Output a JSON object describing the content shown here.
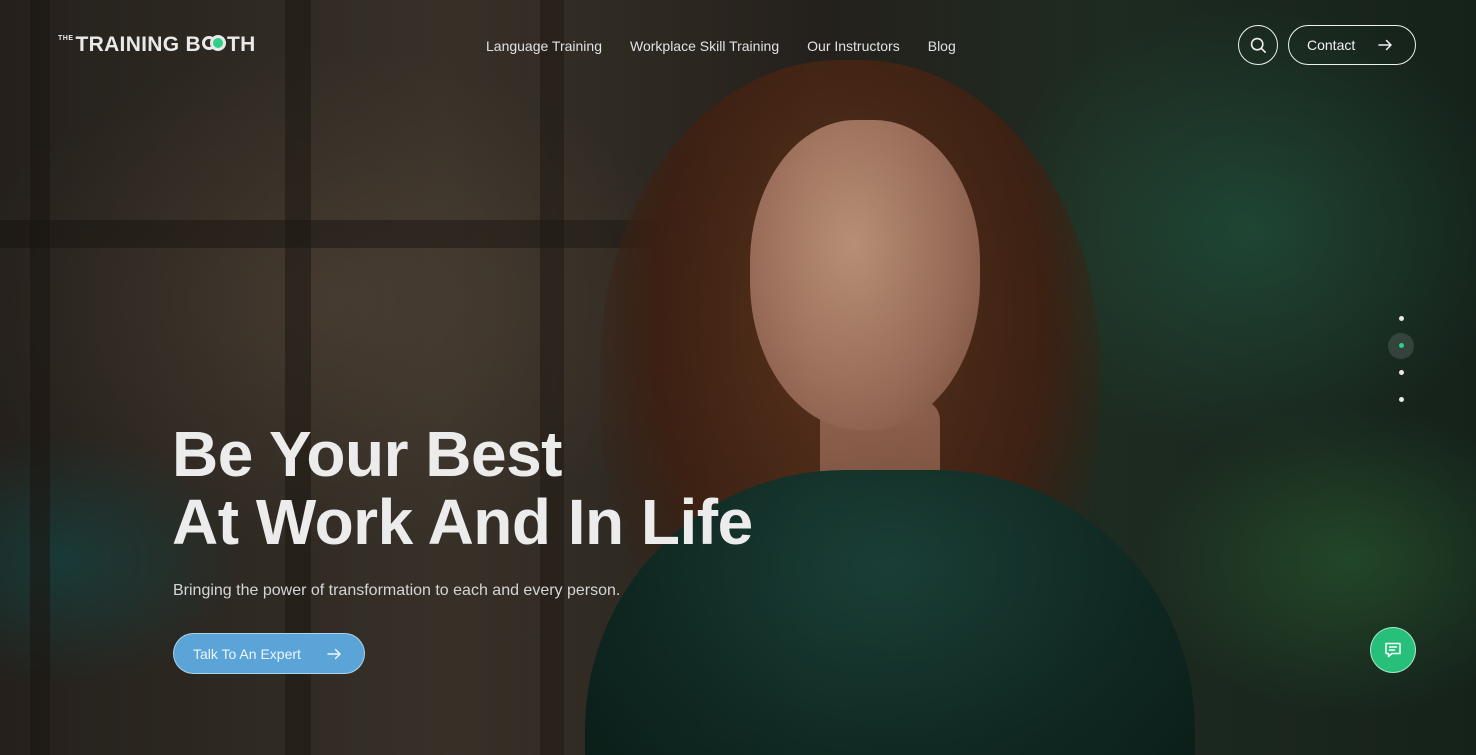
{
  "header": {
    "logo": {
      "prefix": "THE",
      "text_before": "TRAINING B",
      "text_after": "TH"
    },
    "nav": [
      {
        "label": "Language Training"
      },
      {
        "label": "Workplace Skill Training"
      },
      {
        "label": "Our Instructors"
      },
      {
        "label": "Blog"
      }
    ],
    "search_icon": "search-icon",
    "contact": {
      "label": "Contact",
      "icon": "arrow-right-icon"
    }
  },
  "hero": {
    "headline_line1": "Be Your Best",
    "headline_line2": "At Work And In Life",
    "subtitle": "Bringing the power of transformation to each and every person.",
    "cta": {
      "label": "Talk To An Expert",
      "icon": "arrow-right-icon"
    }
  },
  "slider": {
    "total": 4,
    "active_index": 1
  },
  "chat": {
    "icon": "chat-icon"
  },
  "colors": {
    "accent": "#2ecf8a",
    "cta": "#5aa4d8",
    "chat": "#27c07a"
  }
}
